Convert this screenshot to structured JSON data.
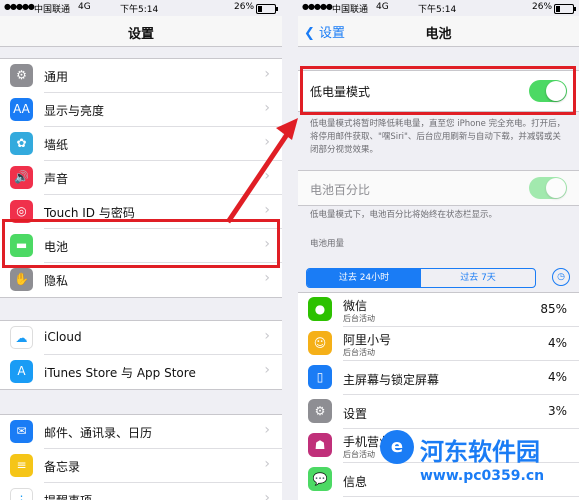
{
  "left_screen": {
    "status": {
      "carrier": "中国联通",
      "network": "4G",
      "time": "下午5:14",
      "battery": "26%"
    },
    "title": "设置",
    "group1": [
      {
        "label": "通用",
        "icon": "gear-icon",
        "color": "#8e8e93",
        "glyph": "⚙"
      },
      {
        "label": "显示与亮度",
        "icon": "display-icon",
        "color": "#1a7cf5",
        "glyph": "AA"
      },
      {
        "label": "墙纸",
        "icon": "wallpaper-icon",
        "color": "#33aadd",
        "glyph": "✿"
      },
      {
        "label": "声音",
        "icon": "sound-icon",
        "color": "#f0304b",
        "glyph": "🔊"
      },
      {
        "label": "Touch ID 与密码",
        "icon": "fingerprint-icon",
        "color": "#f0304b",
        "glyph": "◎"
      },
      {
        "label": "电池",
        "icon": "battery-icon",
        "color": "#4cd964",
        "glyph": "▬"
      },
      {
        "label": "隐私",
        "icon": "hand-icon",
        "color": "#8e8e93",
        "glyph": "✋"
      }
    ],
    "group2": [
      {
        "label": "iCloud",
        "icon": "cloud-icon",
        "color": "#ffffff",
        "glyph": "☁"
      },
      {
        "label": "iTunes Store 与 App Store",
        "icon": "app-store-icon",
        "color": "#1a9cf5",
        "glyph": "A"
      }
    ],
    "group3": [
      {
        "label": "邮件、通讯录、日历",
        "icon": "mail-icon",
        "color": "#1a7cf5",
        "glyph": "✉"
      },
      {
        "label": "备忘录",
        "icon": "notes-icon",
        "color": "#f5c518",
        "glyph": "≡"
      },
      {
        "label": "提醒事项",
        "icon": "reminders-icon",
        "color": "#ffffff",
        "glyph": "⋮"
      }
    ]
  },
  "right_screen": {
    "status": {
      "carrier": "中国联通",
      "network": "4G",
      "time": "下午5:14",
      "battery": "26%"
    },
    "back_label": "设置",
    "title": "电池",
    "low_power_label": "低电量模式",
    "low_power_on": true,
    "low_power_desc": "低电量模式将暂时降低耗电量，直至您 iPhone 完全充电。打开后，将停用邮件获取、\"嘿Siri\"、后台应用刷新与自动下载，并减弱或关闭部分视觉效果。",
    "percent_label": "电池百分比",
    "percent_on": true,
    "percent_desc": "低电量模式下，电池百分比将始终在状态栏显示。",
    "usage_header": "电池用量",
    "tab_24h": "过去 24小时",
    "tab_7d": "过去 7天",
    "apps": [
      {
        "name": "微信",
        "sub": "后台活动",
        "pct": "85%",
        "icon": "wechat-icon",
        "color": "#2dc100",
        "glyph": "●"
      },
      {
        "name": "阿里小号",
        "sub": "后台活动",
        "pct": "4%",
        "icon": "alitrumpet-icon",
        "color": "#f5b018",
        "glyph": "☺"
      },
      {
        "name": "主屏幕与锁定屏幕",
        "sub": "",
        "pct": "4%",
        "icon": "home-screen-icon",
        "color": "#1a7cf5",
        "glyph": "▯"
      },
      {
        "name": "设置",
        "sub": "",
        "pct": "3%",
        "icon": "settings-icon",
        "color": "#8e8e93",
        "glyph": "⚙"
      },
      {
        "name": "手机营业厅",
        "sub": "后台活动",
        "pct": "",
        "icon": "mobile-hall-icon",
        "color": "#c0307a",
        "glyph": "☗"
      },
      {
        "name": "信息",
        "sub": "",
        "pct": "",
        "icon": "messages-icon",
        "color": "#4cd964",
        "glyph": "💬"
      }
    ]
  },
  "watermark": {
    "name": "河东软件园",
    "url": "www.pc0359.cn"
  }
}
